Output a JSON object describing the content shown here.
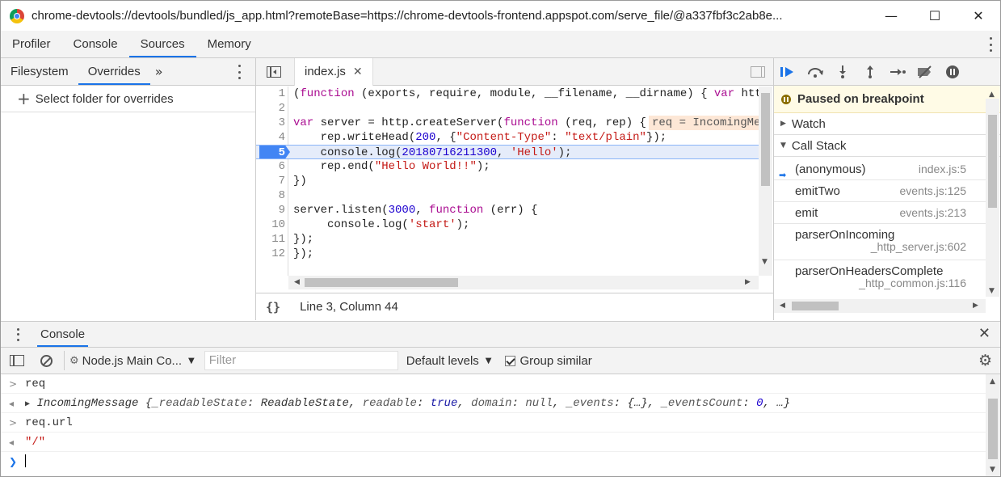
{
  "window": {
    "title": "chrome-devtools://devtools/bundled/js_app.html?remoteBase=https://chrome-devtools-frontend.appspot.com/serve_file/@a337fbf3c2ab8e...",
    "minimize": "—",
    "maximize": "☐",
    "close": "✕"
  },
  "main_tabs": [
    "Profiler",
    "Console",
    "Sources",
    "Memory"
  ],
  "active_main_tab": "Sources",
  "navigator": {
    "tabs": [
      "Filesystem",
      "Overrides"
    ],
    "more": "»",
    "add_folder_label": "Select folder for overrides"
  },
  "editor": {
    "file_tab": "index.js",
    "lines": [
      {
        "n": "1",
        "html": "(<span class='kw'>function</span> (exports, require, module, __filename, __dirname) { <span class='kw'>var</span> http"
      },
      {
        "n": "2",
        "html": ""
      },
      {
        "n": "3",
        "html": "<span class='kw'>var</span> server = http.createServer(<span class='kw'>function</span> (req, rep) {"
      },
      {
        "n": "4",
        "html": "    rep.writeHead(<span class='num'>200</span>, {<span class='str'>\"Content-Type\"</span>: <span class='str'>\"text/plain\"</span>});"
      },
      {
        "n": "5",
        "html": "    console.log(<span class='num'>20180716211300</span>, <span class='str'>'Hello'</span>);"
      },
      {
        "n": "6",
        "html": "    rep.end(<span class='str'>\"Hello World!!\"</span>);"
      },
      {
        "n": "7",
        "html": "})"
      },
      {
        "n": "8",
        "html": ""
      },
      {
        "n": "9",
        "html": "server.listen(<span class='num'>3000</span>, <span class='kw'>function</span> (err) {"
      },
      {
        "n": "10",
        "html": "     console.log(<span class='str'>'start'</span>);"
      },
      {
        "n": "11",
        "html": "});"
      },
      {
        "n": "12",
        "html": "});"
      }
    ],
    "inline_value": "req = IncomingMe",
    "status": "Line 3, Column 44",
    "format_icon": "{}"
  },
  "debugger": {
    "paused_message": "Paused on breakpoint",
    "watch_label": "Watch",
    "callstack_label": "Call Stack",
    "frames": [
      {
        "name": "(anonymous)",
        "location": "index.js:5",
        "current": true
      },
      {
        "name": "emitTwo",
        "location": "events.js:125"
      },
      {
        "name": "emit",
        "location": "events.js:213"
      },
      {
        "name": "parserOnIncoming",
        "location": "_http_server.js:602"
      },
      {
        "name": "parserOnHeadersComplete",
        "location": "_http_common.js:116"
      }
    ]
  },
  "drawer": {
    "tab": "Console",
    "context": "Node.js Main Co...",
    "filter_placeholder": "Filter",
    "levels": "Default levels",
    "group_similar": "Group similar",
    "group_similar_checked": true
  },
  "console_lines": [
    {
      "kind": "input",
      "prefix": ">",
      "html": "req"
    },
    {
      "kind": "output",
      "prefix": "◂",
      "html": "<span style='font-style:normal;font-size:10px;color:#444'>▶</span> <span class='obj'>IncomingMessage {<span class='k'>_readableState</span>: ReadableState, <span class='k'>readable</span>: <span class='v-kw'>true</span>, <span class='k'>domain</span>: <span class='k'>null</span>, <span class='k'>_events</span>: {…}, <span class='k'>_eventsCount</span>: <span class='v-num'>0</span>, …}</span>"
    },
    {
      "kind": "input",
      "prefix": ">",
      "html": "req.url"
    },
    {
      "kind": "output",
      "prefix": "◂",
      "html": "<span class='cstr'>\"/\"</span>"
    }
  ],
  "colors": {
    "accent": "#1a73e8",
    "paused_bg": "#fffbe6"
  }
}
